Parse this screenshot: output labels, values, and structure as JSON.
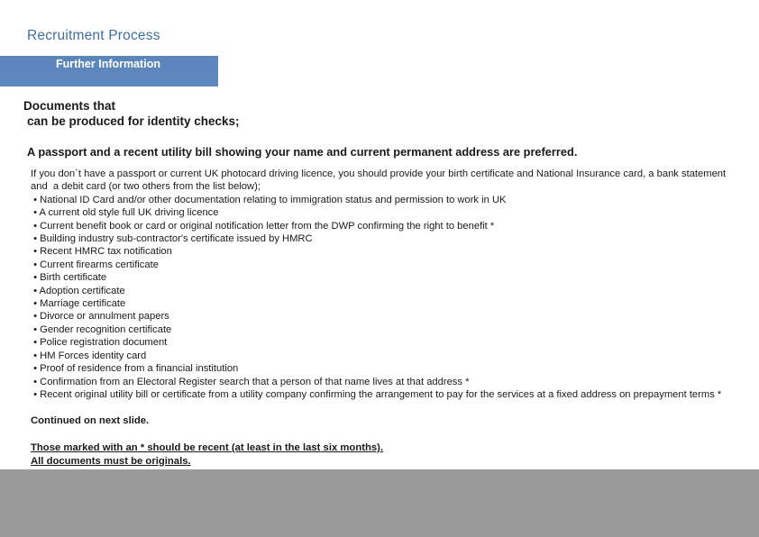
{
  "slide": {
    "title": "Recruitment Process",
    "banner_label": "Further Information",
    "heading_line_1": "Documents that",
    "heading_line_2": "can be produced for identity checks;",
    "lead": "A passport  and a recent utility bill showing your name and current permanent address are preferred.",
    "body_lines": [
      "If you don`t have a passport or current UK photocard driving licence, you should provide your birth certificate and National Insurance card, a bank statement",
      "and  a debit card (or two others from the list below);",
      " • National ID Card and/or other documentation relating to immigration status and permission to work in UK",
      " • A current old style full UK driving licence",
      " • Current benefit book or card or original notification letter from the DWP confirming the right to benefit *",
      " • Building industry sub-contractor's certificate issued by HMRC",
      " • Recent HMRC tax notification",
      " • Current firearms certificate",
      " • Birth certificate",
      " • Adoption certificate",
      " • Marriage certificate",
      " • Divorce or annulment papers",
      " • Gender recognition certificate",
      " • Police registration document",
      " • HM Forces identity card",
      " • Proof of residence from a financial institution",
      " • Confirmation from an Electoral Register search that a person of that name lives at that address *",
      " • Recent original utility bill or certificate from a utility company confirming the arrangement to pay for the services at a fixed address on prepayment terms *"
    ],
    "continued": "Continued on next slide.",
    "footnote_lines": [
      "Those marked with an * should be recent (at least in the last six months).",
      "All documents must be originals."
    ],
    "colors": {
      "title": "#3d6fa8",
      "banner": "#5c87be",
      "bottom_band": "#9a9a9a"
    }
  }
}
